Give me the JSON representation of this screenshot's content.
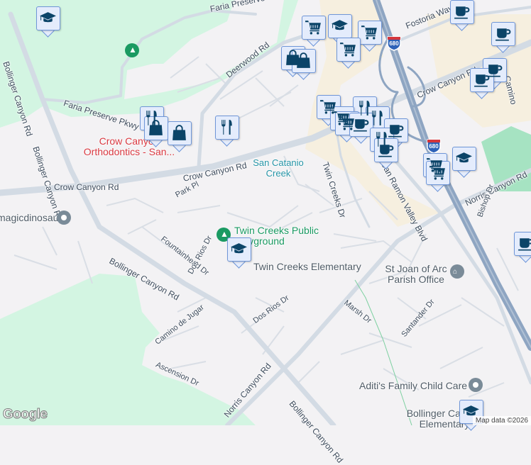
{
  "roads": {
    "faria_top": "Faria Preserve Pkwy",
    "faria": "Faria Preserve Pkwy",
    "bollinger_1": "Bollinger Canyon Rd",
    "bollinger_2": "Bollinger Canyon Rd",
    "bollinger_3": "Bollinger Canyon Rd",
    "bollinger_4": "Bollinger Canyon Rd",
    "deerwood": "Deerwood Rd",
    "crow_canyon_1": "Crow Canyon Rd",
    "crow_canyon_2": "Crow Canyon Rd",
    "crow_canyon_3": "Crow Canyon Rd",
    "park_pl": "Park Pl",
    "twin_creeks": "Twin Creeks Dr",
    "san_ramon_valley": "San Ramon Valley Blvd",
    "fostoria": "Fostoria Way",
    "camino": "Camino",
    "norris_1": "Norris Canyon Rd",
    "norris_2": "Norris Canyon Rd",
    "bishop": "Bishop Dr",
    "fountainhead": "Fountainhead Dr",
    "dos_rios_1": "Dos Rios Dr",
    "dos_rios_2": "Dos Rios Dr",
    "marsh": "Marsh Dr",
    "santander": "Santander Dr",
    "camino_de_jugar": "Camino de Jugar",
    "ascension": "Ascension Dr",
    "highway_shield": "680"
  },
  "places": {
    "orthodontics": "Crow Canyon Orthodontics - San...",
    "san_catanio": "San Catanio Creek",
    "magicdinosaur": "magicdinosaur",
    "playground": "Twin Creeks Public Playground",
    "elementary": "Twin Creeks Elementary",
    "st_joan": "St Joan of Arc Parish Office",
    "aditi": "Aditi's Family Child Care",
    "bollinger_elem": "Bollinger Canyon Elementary"
  },
  "footer": {
    "logo": "Google",
    "attribution": "Map data ©2026"
  },
  "colors": {
    "marker_fill": "#e4ecfc",
    "marker_border": "#6f96d8",
    "marker_icon": "#0b4468",
    "park": "#d3f5e2",
    "highway": "#8ea5c2",
    "commercial": "#f6efdf"
  }
}
